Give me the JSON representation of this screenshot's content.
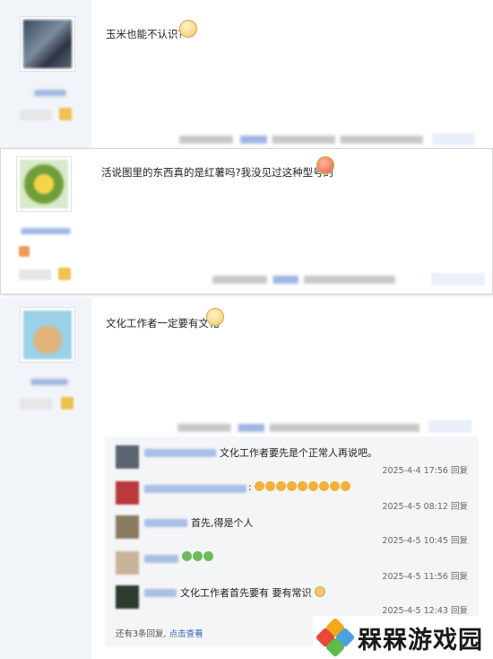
{
  "posts": [
    {
      "content": "玉米也能不认识?"
    },
    {
      "content": "活说图里的东西真的是红薯吗?我没见过这种型号的"
    },
    {
      "content": "文化工作者一定要有文化"
    }
  ],
  "comments": [
    {
      "text": "文化工作者要先是个正常人再说吧。",
      "time": "2025-4-4 17:56",
      "reply": "回复"
    },
    {
      "text": ":",
      "time": "2025-4-5 08:12",
      "reply": "回复"
    },
    {
      "text": "首先,得是个人",
      "time": "2025-4-5 10:45",
      "reply": "回复"
    },
    {
      "text": "",
      "time": "2025-4-5 11:56",
      "reply": "回复"
    },
    {
      "text": "文化工作者首先要有 要有常识",
      "time": "2025-4-5 12:43",
      "reply": "回复"
    }
  ],
  "more": {
    "text": "还有3条回复,",
    "link": "点击查看"
  },
  "watermark": {
    "text": "槑槑游戏园"
  },
  "colors": {
    "sidebar": "#f1f4f8",
    "link": "#2d64b3",
    "comment_bg": "#f4f5f7"
  }
}
